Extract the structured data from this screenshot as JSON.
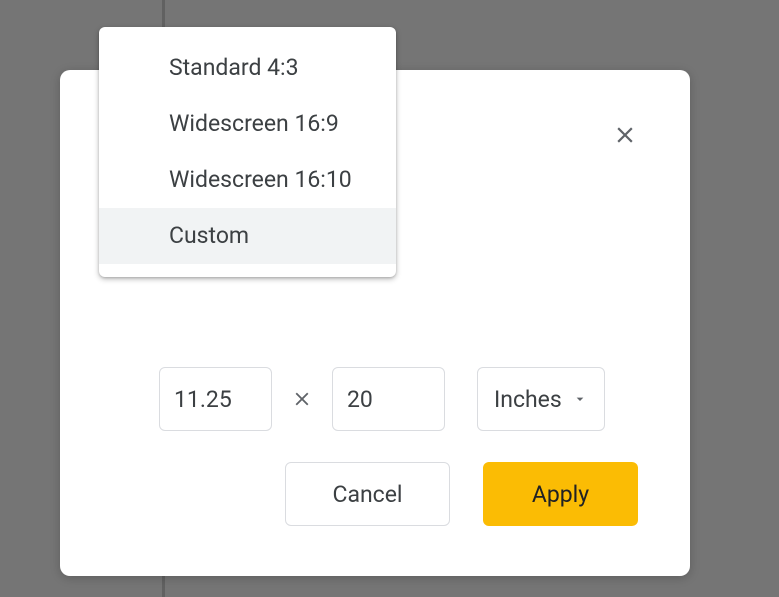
{
  "dropdown": {
    "options": [
      {
        "label": "Standard 4:3",
        "selected": false
      },
      {
        "label": "Widescreen 16:9",
        "selected": false
      },
      {
        "label": "Widescreen 16:10",
        "selected": false
      },
      {
        "label": "Custom",
        "selected": true
      }
    ]
  },
  "dimensions": {
    "width": "11.25",
    "height": "20",
    "unit": "Inches"
  },
  "buttons": {
    "cancel": "Cancel",
    "apply": "Apply"
  }
}
